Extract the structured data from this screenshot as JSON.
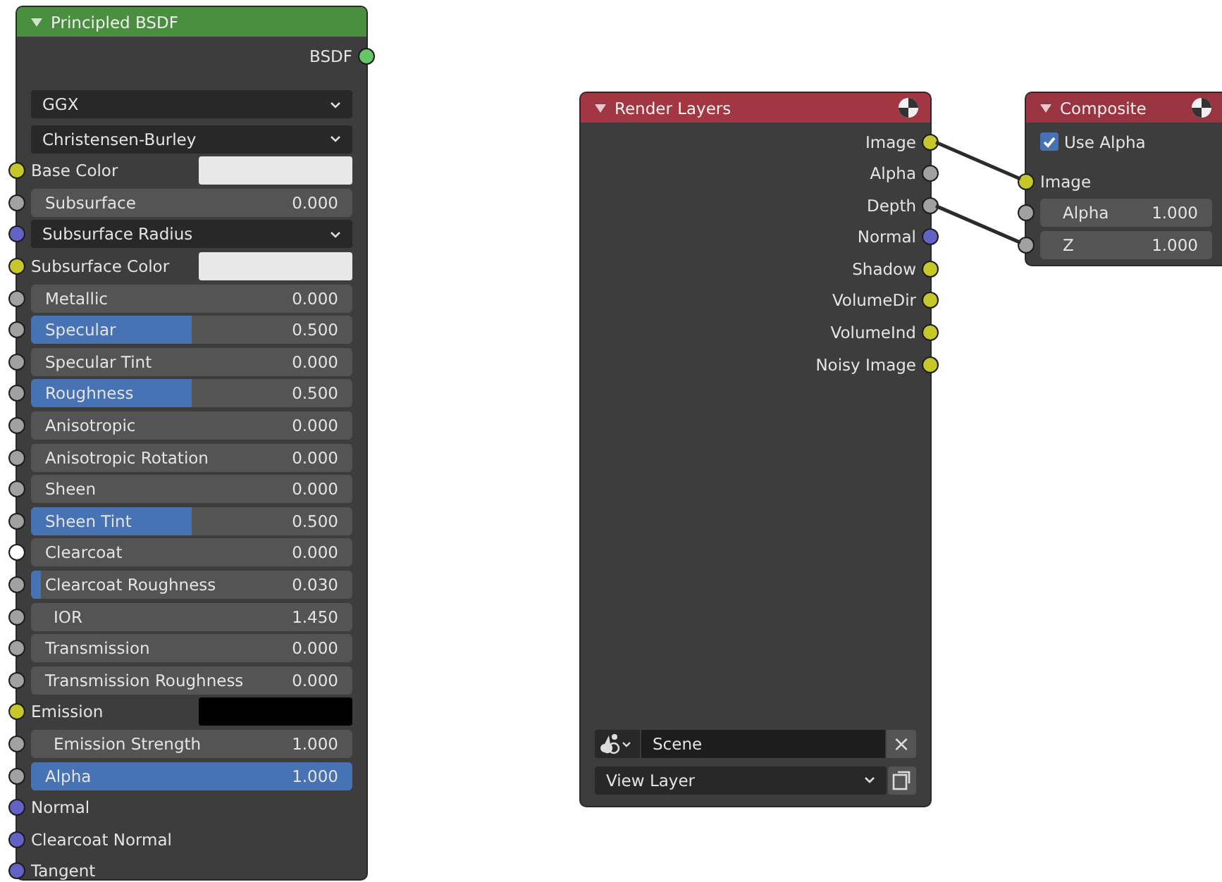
{
  "principled": {
    "title": "Principled BSDF",
    "rows": [
      {
        "kind": "output",
        "label": "BSDF",
        "socket": {
          "color": "#63c763"
        }
      },
      {
        "kind": "dropdown",
        "value": "GGX"
      },
      {
        "kind": "dropdown",
        "value": "Christensen-Burley"
      },
      {
        "kind": "color",
        "label": "Base Color",
        "socket": {
          "color": "#c7c729"
        },
        "color": "#e8e8e8"
      },
      {
        "kind": "slider",
        "label": "Subsurface",
        "value": "0.000",
        "socket": {
          "color": "#a1a1a1"
        }
      },
      {
        "kind": "dropdown",
        "value": "Subsurface Radius",
        "socket": {
          "color": "#6363c7"
        }
      },
      {
        "kind": "color",
        "label": "Subsurface Color",
        "socket": {
          "color": "#c7c729"
        },
        "color": "#e8e8e8"
      },
      {
        "kind": "slider",
        "label": "Metallic",
        "value": "0.000",
        "socket": {
          "color": "#a1a1a1"
        }
      },
      {
        "kind": "slider",
        "label": "Specular",
        "value": "0.500",
        "level": 0.5,
        "socket": {
          "color": "#a1a1a1"
        }
      },
      {
        "kind": "slider",
        "label": "Specular Tint",
        "value": "0.000",
        "socket": {
          "color": "#a1a1a1"
        }
      },
      {
        "kind": "slider",
        "label": "Roughness",
        "value": "0.500",
        "level": 0.5,
        "socket": {
          "color": "#a1a1a1"
        }
      },
      {
        "kind": "slider",
        "label": "Anisotropic",
        "value": "0.000",
        "socket": {
          "color": "#a1a1a1"
        }
      },
      {
        "kind": "slider",
        "label": "Anisotropic Rotation",
        "value": "0.000",
        "socket": {
          "color": "#a1a1a1"
        }
      },
      {
        "kind": "slider",
        "label": "Sheen",
        "value": "0.000",
        "socket": {
          "color": "#a1a1a1"
        }
      },
      {
        "kind": "slider",
        "label": "Sheen Tint",
        "value": "0.500",
        "level": 0.5,
        "socket": {
          "color": "#a1a1a1"
        }
      },
      {
        "kind": "slider",
        "label": "Clearcoat",
        "value": "0.000",
        "socket": {
          "color": "#ffffff"
        }
      },
      {
        "kind": "slider",
        "label": "Clearcoat Roughness",
        "value": "0.030",
        "level": 0.03,
        "socket": {
          "color": "#a1a1a1"
        }
      },
      {
        "kind": "number",
        "label": "IOR",
        "value": "1.450",
        "socket": {
          "color": "#a1a1a1"
        }
      },
      {
        "kind": "slider",
        "label": "Transmission",
        "value": "0.000",
        "socket": {
          "color": "#a1a1a1"
        }
      },
      {
        "kind": "slider",
        "label": "Transmission Roughness",
        "value": "0.000",
        "socket": {
          "color": "#a1a1a1"
        }
      },
      {
        "kind": "color",
        "label": "Emission",
        "socket": {
          "color": "#c7c729"
        },
        "color": "#000000"
      },
      {
        "kind": "number",
        "label": "Emission Strength",
        "value": "1.000",
        "socket": {
          "color": "#a1a1a1"
        }
      },
      {
        "kind": "slider",
        "label": "Alpha",
        "value": "1.000",
        "level": 1,
        "socket": {
          "color": "#a1a1a1"
        }
      },
      {
        "kind": "input",
        "label": "Normal",
        "socket": {
          "color": "#6363c7"
        }
      },
      {
        "kind": "input",
        "label": "Clearcoat Normal",
        "socket": {
          "color": "#6363c7"
        }
      },
      {
        "kind": "input",
        "label": "Tangent",
        "socket": {
          "color": "#6363c7"
        }
      }
    ]
  },
  "render_layers": {
    "title": "Render Layers",
    "outputs": [
      {
        "label": "Image",
        "color": "#c7c729",
        "linked": true
      },
      {
        "label": "Alpha",
        "color": "#a1a1a1",
        "linked": false
      },
      {
        "label": "Depth",
        "color": "#a1a1a1",
        "linked": true
      },
      {
        "label": "Normal",
        "color": "#6363c7",
        "linked": false
      },
      {
        "label": "Shadow",
        "color": "#c7c729",
        "linked": false
      },
      {
        "label": "VolumeDir",
        "color": "#c7c729",
        "linked": false
      },
      {
        "label": "VolumeInd",
        "color": "#c7c729",
        "linked": false
      },
      {
        "label": "Noisy Image",
        "color": "#c7c729",
        "linked": false
      }
    ],
    "scene": "Scene",
    "close": "×",
    "view_layer": "View Layer"
  },
  "composite": {
    "title": "Composite",
    "use_alpha": {
      "label": "Use Alpha",
      "checked": true
    },
    "rows": [
      {
        "kind": "input",
        "label": "Image",
        "color": "#c7c729",
        "linked": true
      },
      {
        "kind": "number",
        "label": "Alpha",
        "value": "1.000",
        "color": "#a1a1a1",
        "linked": false
      },
      {
        "kind": "number",
        "label": "Z",
        "value": "1.000",
        "color": "#a1a1a1",
        "linked": true
      }
    ]
  }
}
